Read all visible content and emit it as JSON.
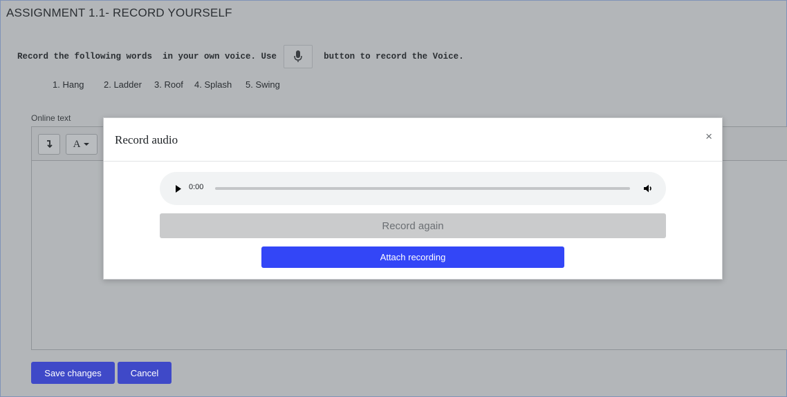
{
  "page": {
    "title": "ASSIGNMENT 1.1- RECORD YOURSELF",
    "instruction_before": "Record the following words  in your own voice. Use",
    "instruction_after": "button to record the Voice.",
    "mic_icon": "microphone-icon",
    "words": [
      "1. Hang",
      "2. Ladder",
      "3. Roof",
      "4. Splash",
      "5. Swing"
    ]
  },
  "editor": {
    "label": "Online text",
    "toolbar": {
      "expand_icon": "arrow-down-icon",
      "font_label": "A",
      "dropdown_icon": "caret-down-icon"
    }
  },
  "form": {
    "save_label": "Save changes",
    "cancel_label": "Cancel"
  },
  "modal": {
    "title": "Record audio",
    "close_glyph": "×",
    "player": {
      "time": "0:00",
      "play_icon": "play-icon",
      "volume_icon": "volume-icon"
    },
    "record_again_label": "Record again",
    "attach_label": "Attach recording"
  },
  "colors": {
    "primary_button": "#3f49c8",
    "attach_button": "#3346f7",
    "overlay_background": "#b3b6b9"
  }
}
